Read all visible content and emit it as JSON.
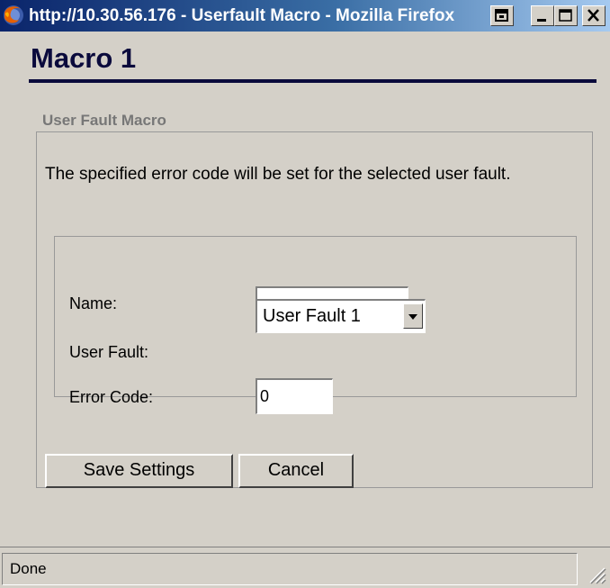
{
  "window": {
    "title": "http://10.30.56.176 - Userfault Macro - Mozilla Firefox"
  },
  "page": {
    "title": "Macro 1",
    "legend": "User Fault Macro",
    "description": "The specified error code will be set for the selected user fault."
  },
  "form": {
    "name_label": "Name:",
    "name_value": "",
    "user_fault_label": "User Fault:",
    "user_fault_value": "User Fault 1",
    "error_code_label": "Error Code:",
    "error_code_value": "0"
  },
  "buttons": {
    "save": "Save Settings",
    "cancel": "Cancel"
  },
  "status": {
    "text": "Done"
  },
  "icons": {
    "app": "firefox-icon",
    "popup": "popup-icon",
    "minimize": "minimize-icon",
    "maximize": "maximize-icon",
    "close": "close-icon",
    "dropdown": "chevron-down-icon",
    "grip": "resize-grip-icon"
  },
  "colors": {
    "title_gradient_start": "#0a246a",
    "title_gradient_end": "#a6caf0",
    "heading": "#0a0a3c",
    "legend": "#777777",
    "face": "#d4d0c8"
  }
}
